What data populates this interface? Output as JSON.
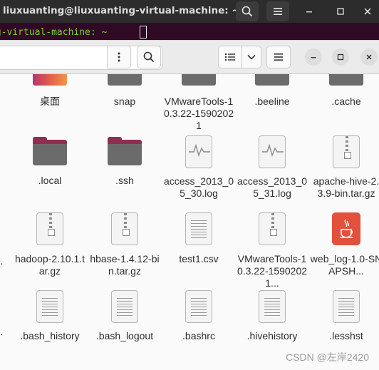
{
  "terminal": {
    "title": "liuxuanting@liuxuanting-virtual-machine: ~",
    "prompt_fragment": "ng-virtual-machine: ~"
  },
  "colors": {
    "folder_dark": "#6b6b6b",
    "folder_pink": "#8e2f52",
    "java_red": "#e2513b",
    "terminal_bg": "#300a24"
  },
  "file_manager": {
    "header": {
      "menu_icon": "vertical-dots-icon",
      "search_icon": "search-icon",
      "view_icon": "list-view-icon",
      "view_dropdown_icon": "chevron-down-icon",
      "hamburger_icon": "hamburger-icon",
      "minimize_icon": "minimize-icon",
      "maximize_icon": "maximize-icon",
      "close_icon": "close-icon"
    },
    "items": [
      {
        "label": "桌面",
        "icon": "desktop-folder-icon"
      },
      {
        "label": "snap",
        "icon": "folder-icon"
      },
      {
        "label": "VMwareTools-10.3.22-15902021",
        "icon": "folder-icon"
      },
      {
        "label": ".beeline",
        "icon": "folder-icon"
      },
      {
        "label": ".cache",
        "icon": "folder-icon"
      },
      {
        "label": ".local",
        "icon": "folder-icon"
      },
      {
        "label": ".ssh",
        "icon": "folder-icon"
      },
      {
        "label": "access_2013_05_30.log",
        "icon": "log-file-icon"
      },
      {
        "label": "access_2013_05_31.log",
        "icon": "log-file-icon"
      },
      {
        "label": "apache-hive-2.3.9-bin.tar.gz",
        "icon": "archive-icon"
      },
      {
        "label": "hadoop-2.10.1.tar.gz",
        "icon": "archive-icon"
      },
      {
        "label": "hbase-1.4.12-bin.tar.gz",
        "icon": "archive-icon"
      },
      {
        "label": "test1.csv",
        "icon": "text-file-icon"
      },
      {
        "label": "VMwareTools-10.3.22-15902021...",
        "icon": "archive-icon"
      },
      {
        "label": "web_log-1.0-SNAPSH...",
        "icon": "java-archive-icon"
      },
      {
        "label": ".bash_history",
        "icon": "text-file-icon"
      },
      {
        "label": ".bash_logout",
        "icon": "text-file-icon"
      },
      {
        "label": ".bashrc",
        "icon": "text-file-icon"
      },
      {
        "label": ".hivehistory",
        "icon": "text-file-icon"
      },
      {
        "label": ".lesshst",
        "icon": "text-file-icon"
      }
    ],
    "edge_fragments": [
      "7.",
      "."
    ]
  },
  "watermark": "CSDN @左岸2420"
}
